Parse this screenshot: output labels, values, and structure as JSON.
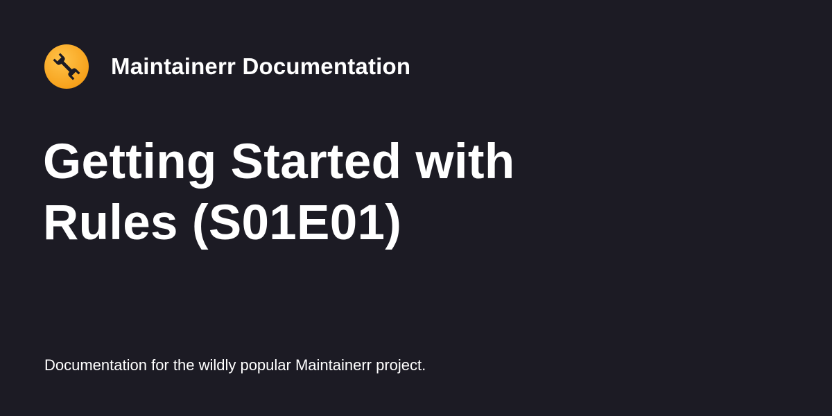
{
  "header": {
    "logo_icon": "wrench-icon",
    "site_name": "Maintainerr Documentation"
  },
  "main": {
    "title": "Getting Started with Rules (S01E01)",
    "description": "Documentation for the wildly popular Maintainerr project."
  },
  "colors": {
    "background": "#1c1b24",
    "text": "#ffffff",
    "logo_accent": "#f7a21c"
  }
}
